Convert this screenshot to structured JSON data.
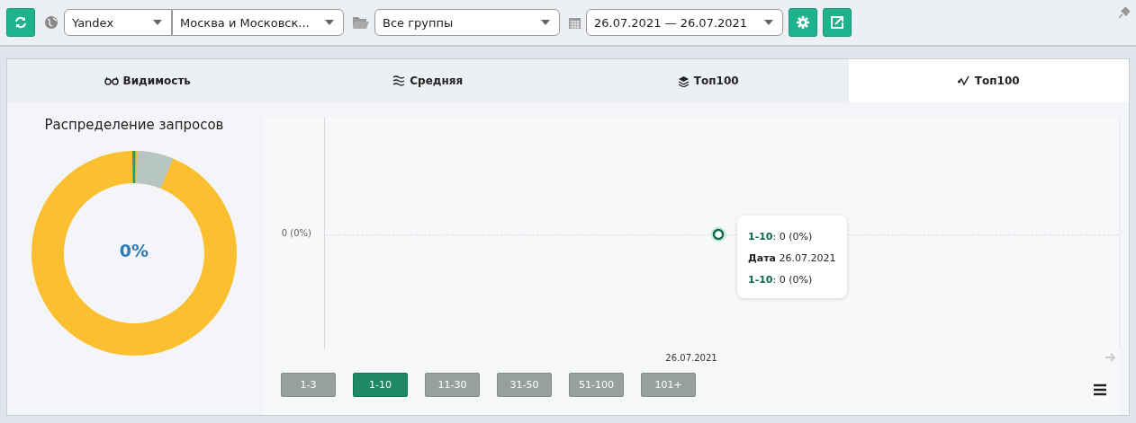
{
  "toolbar": {
    "engine": "Yandex",
    "region": "Москва и Московск...",
    "group": "Все группы",
    "date_range": "26.07.2021 — 26.07.2021"
  },
  "tabs": [
    {
      "label": "Видимость",
      "kind": "visibility",
      "selected": false
    },
    {
      "label": "Средняя",
      "kind": "average",
      "selected": false
    },
    {
      "label": "Топ100",
      "kind": "stack",
      "selected": false
    },
    {
      "label": "Топ100",
      "kind": "trend",
      "selected": true
    }
  ],
  "distribution": {
    "title": "Распределение запросов",
    "center_value": "0%"
  },
  "chart": {
    "y_label": "0 (0%)",
    "x_label": "26.07.2021",
    "tooltip": {
      "series_top": "1-10",
      "value_top": ": 0 (0%)",
      "date_label": "Дата",
      "date": "26.07.2021",
      "series": "1-10",
      "value": ": 0 (0%)"
    }
  },
  "ranges": [
    {
      "label": "1-3",
      "selected": false
    },
    {
      "label": "1-10",
      "selected": true
    },
    {
      "label": "11-30",
      "selected": false
    },
    {
      "label": "31-50",
      "selected": false
    },
    {
      "label": "51-100",
      "selected": false
    },
    {
      "label": "101+",
      "selected": false
    }
  ]
}
